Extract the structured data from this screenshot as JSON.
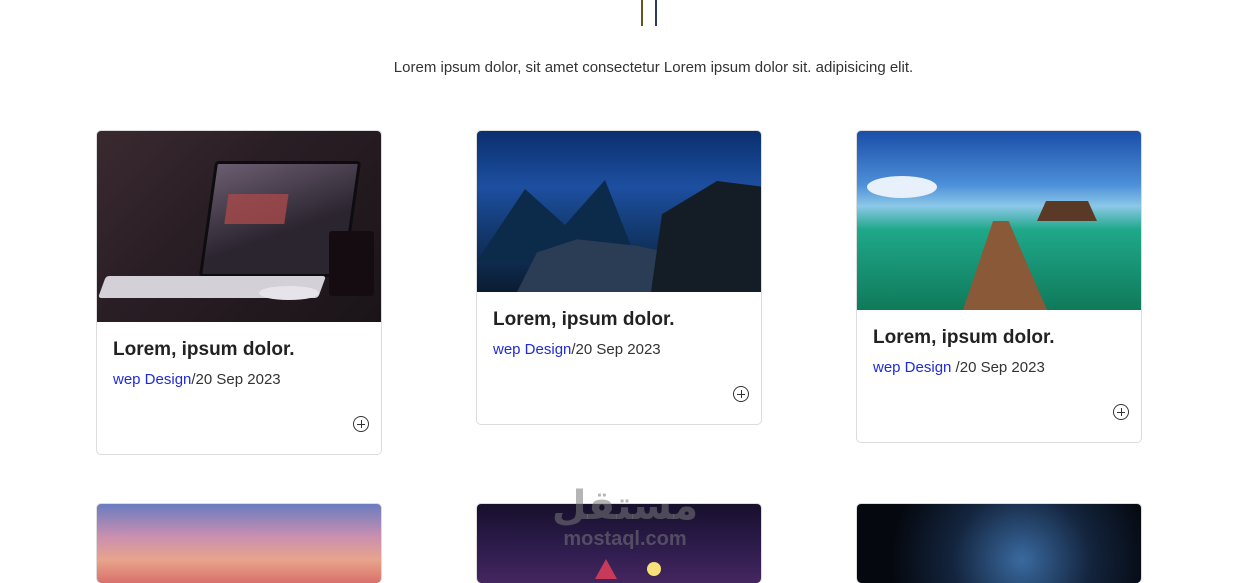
{
  "intro": "Lorem ipsum dolor, sit amet consectetur Lorem ipsum dolor sit. adipisicing elit.",
  "cards": [
    {
      "title": "Lorem, ipsum dolor.",
      "category": "wep Design",
      "date": "/20 Sep 2023",
      "image": "laptop-on-desk"
    },
    {
      "title": "Lorem, ipsum dolor.",
      "category": "wep Design",
      "date": "/20 Sep 2023",
      "image": "panther-over-city"
    },
    {
      "title": "Lorem, ipsum dolor.",
      "category": "wep Design",
      "date": " /20 Sep 2023",
      "image": "sea-pier-huts"
    }
  ],
  "row2_images": [
    "sunset-sky",
    "night-scene",
    "space-astronaut"
  ],
  "action_icon": "plus-circle-icon",
  "watermark": {
    "arabic": "مستقل",
    "latin": "mostaql.com"
  }
}
